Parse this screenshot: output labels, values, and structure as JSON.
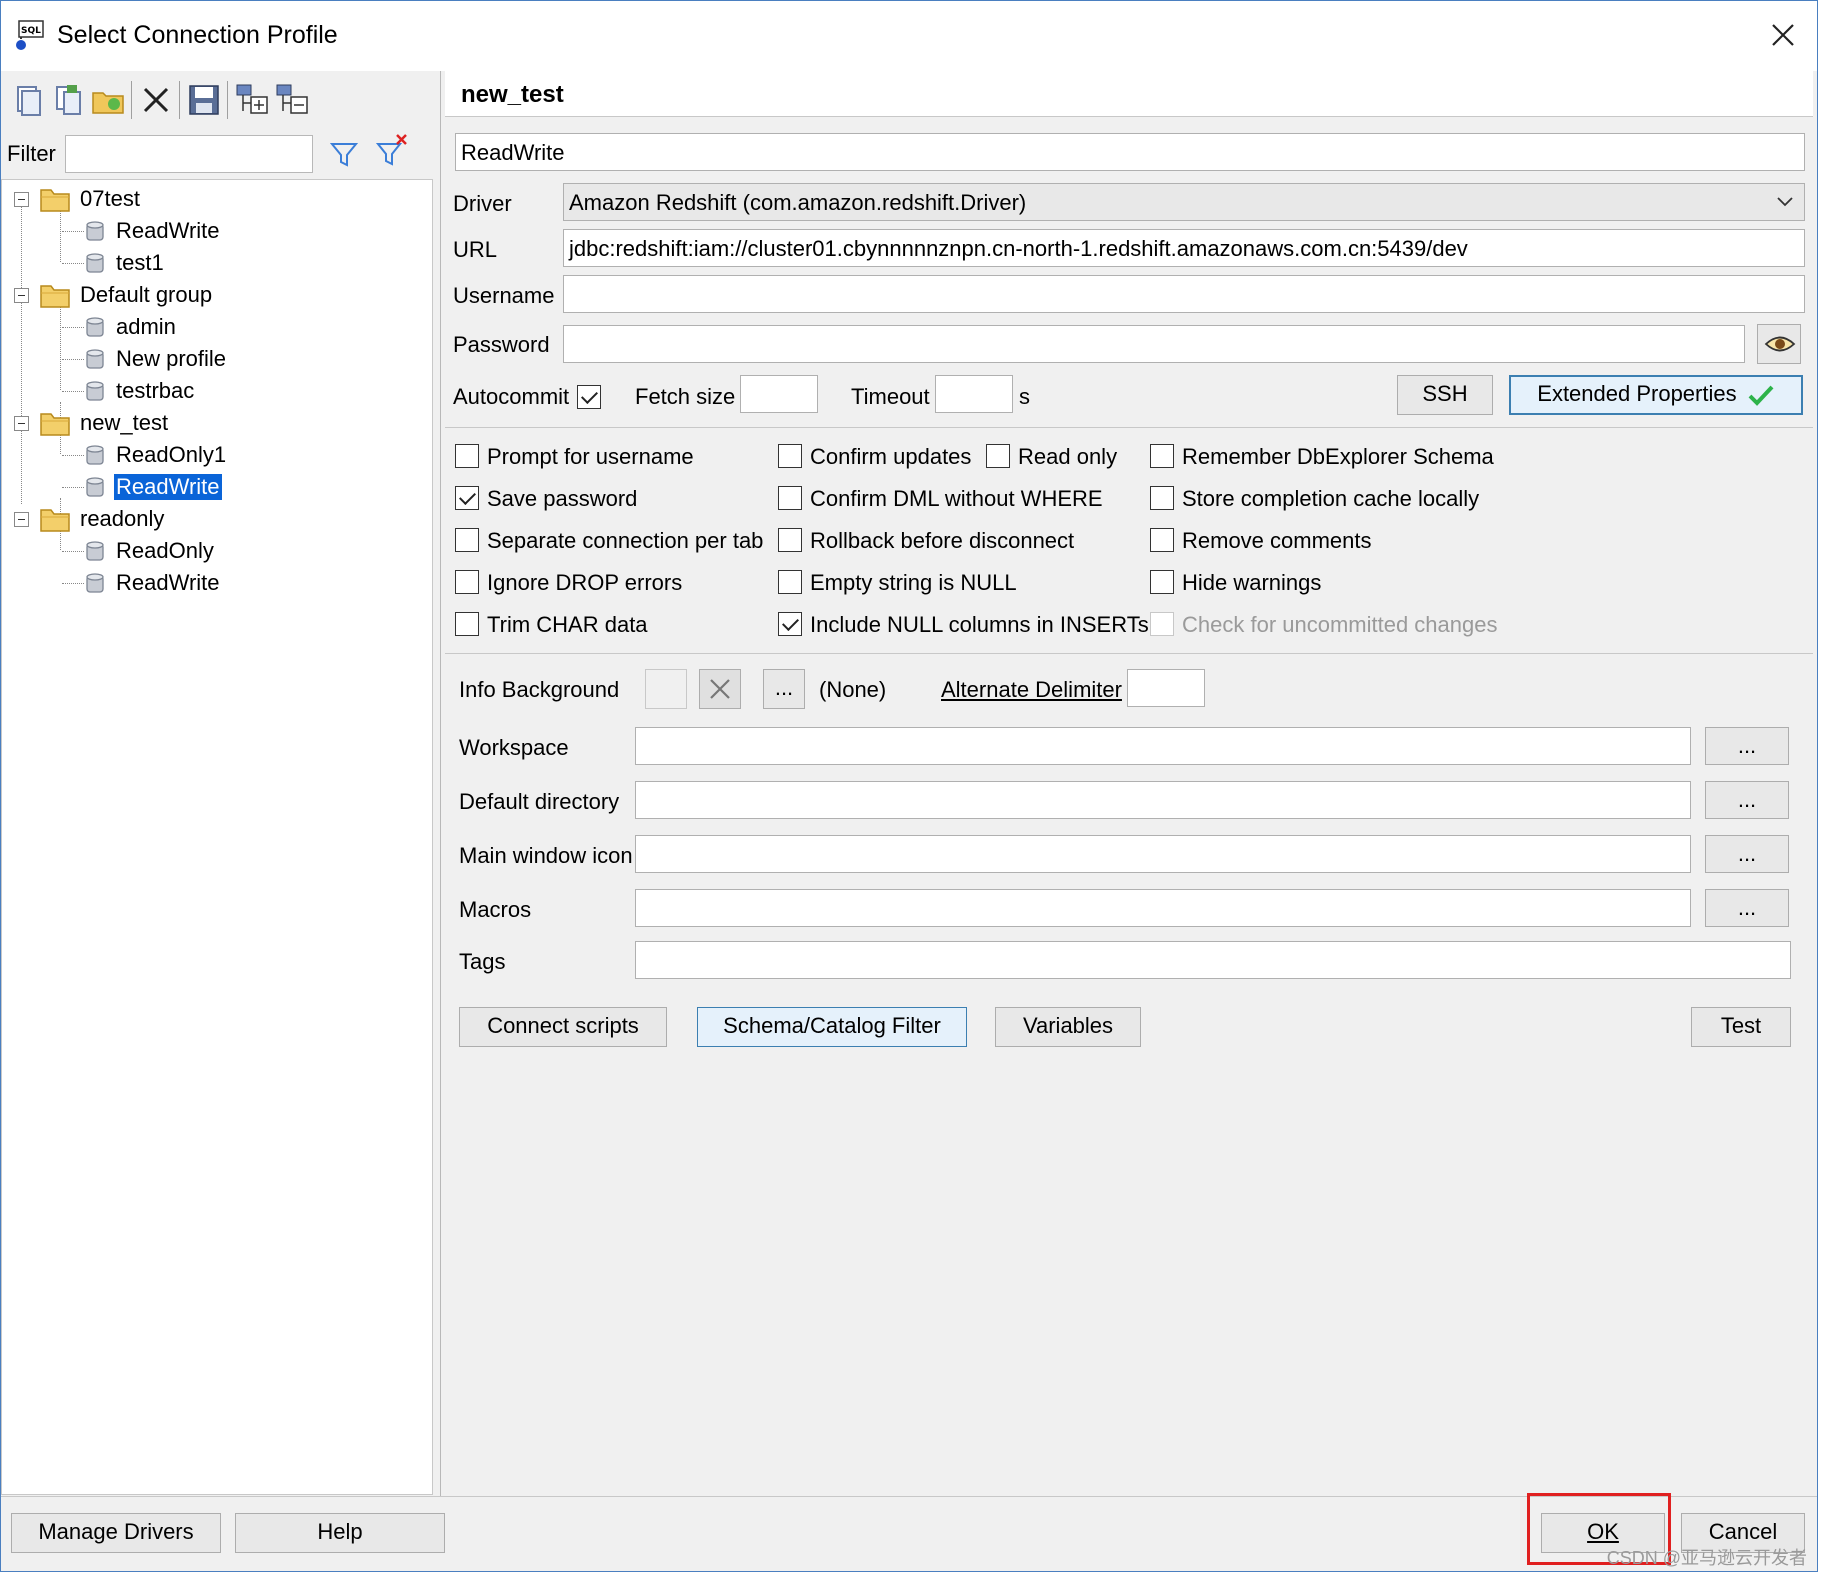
{
  "window": {
    "title": "Select Connection Profile"
  },
  "left": {
    "filter_label": "Filter",
    "filter_value": "",
    "tree": [
      {
        "label": "07test",
        "type": "group"
      },
      {
        "label": "ReadWrite",
        "type": "profile"
      },
      {
        "label": "test1",
        "type": "profile"
      },
      {
        "label": "Default group",
        "type": "group"
      },
      {
        "label": "admin",
        "type": "profile"
      },
      {
        "label": "New profile",
        "type": "profile"
      },
      {
        "label": "testrbac",
        "type": "profile"
      },
      {
        "label": "new_test",
        "type": "group"
      },
      {
        "label": "ReadOnly1",
        "type": "profile"
      },
      {
        "label": "ReadWrite",
        "type": "profile",
        "selected": true
      },
      {
        "label": "readonly",
        "type": "group"
      },
      {
        "label": "ReadOnly",
        "type": "profile"
      },
      {
        "label": "ReadWrite",
        "type": "profile"
      }
    ]
  },
  "profile": {
    "group_name": "new_test",
    "name": "ReadWrite",
    "driver_label": "Driver",
    "driver_value": "Amazon Redshift (com.amazon.redshift.Driver)",
    "url_label": "URL",
    "url_value": "jdbc:redshift:iam://cluster01.cbynnnnnznpn.cn-north-1.redshift.amazonaws.com.cn:5439/dev",
    "username_label": "Username",
    "username_value": "",
    "password_label": "Password",
    "password_value": "",
    "autocommit_label": "Autocommit",
    "fetch_size_label": "Fetch size",
    "timeout_label": "Timeout",
    "timeout_unit": "s",
    "ssh_label": "SSH",
    "extended_label": "Extended Properties"
  },
  "options": {
    "col1": [
      {
        "label": "Prompt for username",
        "checked": false
      },
      {
        "label": "Save password",
        "checked": true
      },
      {
        "label": "Separate connection per tab",
        "checked": false
      },
      {
        "label": "Ignore DROP errors",
        "checked": false
      },
      {
        "label": "Trim CHAR data",
        "checked": false
      }
    ],
    "col2": [
      {
        "label": "Confirm updates",
        "checked": false
      },
      {
        "label": "Confirm DML without WHERE",
        "checked": false
      },
      {
        "label": "Rollback before disconnect",
        "checked": false
      },
      {
        "label": "Empty string is NULL",
        "checked": false
      },
      {
        "label": "Include NULL columns in INSERTs",
        "checked": true
      }
    ],
    "read_only": {
      "label": "Read only",
      "checked": false
    },
    "col3": [
      {
        "label": "Remember DbExplorer Schema",
        "checked": false
      },
      {
        "label": "Store completion cache locally",
        "checked": false
      },
      {
        "label": "Remove comments",
        "checked": false
      },
      {
        "label": "Hide warnings",
        "checked": false
      },
      {
        "label": "Check for uncommitted changes",
        "checked": false,
        "disabled": true
      }
    ]
  },
  "extras": {
    "info_bg_label": "Info Background",
    "info_bg_value": "(None)",
    "ellipsis": "...",
    "alt_delim_label": "Alternate Delimiter",
    "workspace_label": "Workspace",
    "default_dir_label": "Default directory",
    "main_icon_label": "Main window icon",
    "macros_label": "Macros",
    "tags_label": "Tags"
  },
  "buttons": {
    "connect_scripts": "Connect scripts",
    "schema_filter": "Schema/Catalog Filter",
    "variables": "Variables",
    "test": "Test",
    "manage_drivers": "Manage Drivers",
    "help": "Help",
    "ok": "OK",
    "cancel": "Cancel"
  },
  "watermark": "CSDN @亚马逊云开发者",
  "colors": {
    "selection": "#0a64d8",
    "highlight_box": "#e02020",
    "check_green": "#2db34a"
  }
}
